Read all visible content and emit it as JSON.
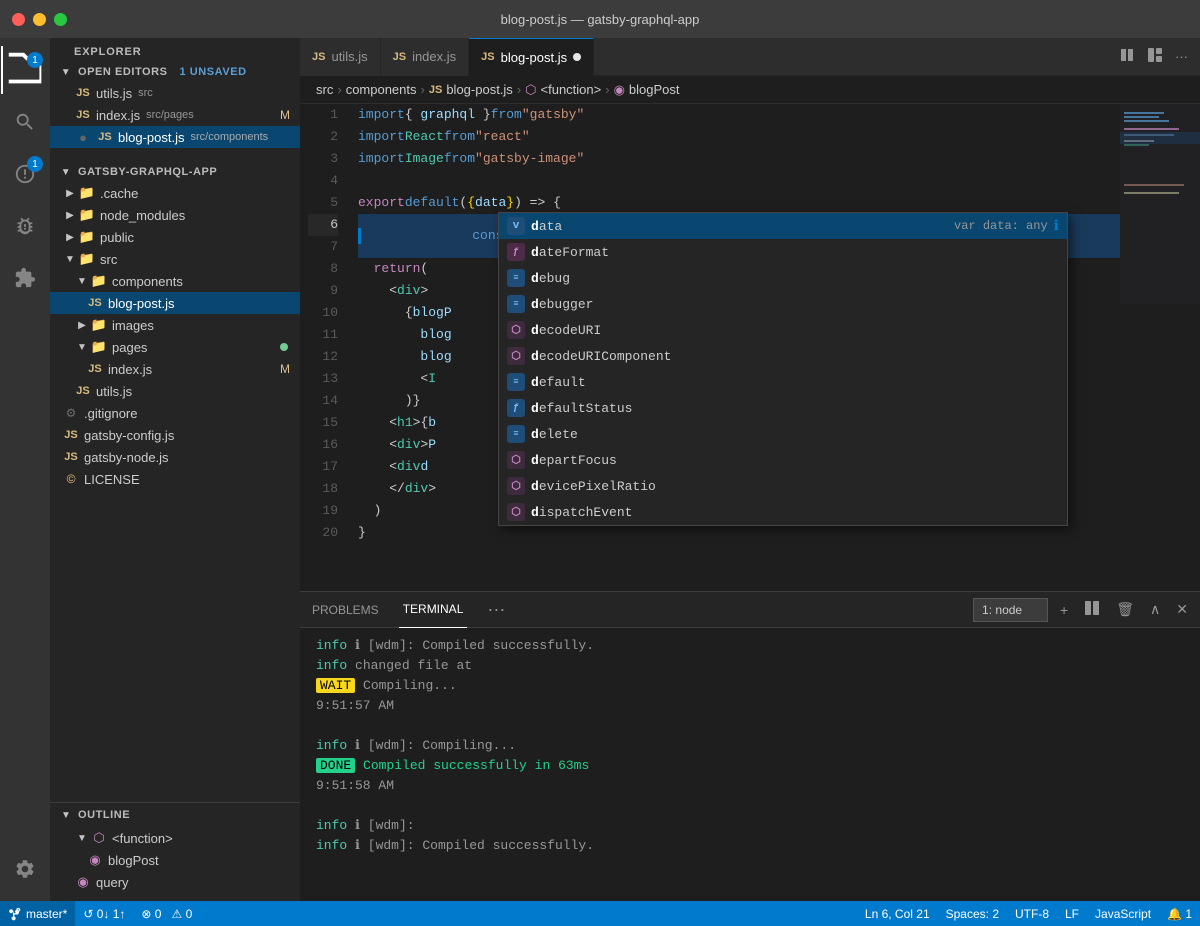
{
  "titlebar": {
    "title": "blog-post.js — gatsby-graphql-app"
  },
  "tabs": [
    {
      "id": "utils",
      "label": "utils.js",
      "type": "js",
      "active": false,
      "modified": false
    },
    {
      "id": "index",
      "label": "index.js",
      "type": "js",
      "active": false,
      "modified": false
    },
    {
      "id": "blog-post",
      "label": "blog-post.js",
      "type": "js",
      "active": true,
      "modified": true
    }
  ],
  "breadcrumb": {
    "parts": [
      "src",
      "components",
      "blog-post.js",
      "<function>",
      "blogPost"
    ]
  },
  "sidebar": {
    "title": "EXPLORER",
    "openEditors": {
      "label": "OPEN EDITORS",
      "badge": "1 UNSAVED"
    },
    "projectName": "GATSBY-GRAPHQL-APP",
    "files": [
      {
        "name": "utils.js",
        "path": "src",
        "type": "js",
        "indent": 2
      },
      {
        "name": "index.js",
        "path": "src/pages",
        "type": "js",
        "indent": 2,
        "badge": "M"
      },
      {
        "name": "blog-post.js",
        "path": "src/components",
        "type": "js",
        "indent": 2,
        "active": true
      },
      {
        "name": ".cache",
        "type": "folder",
        "indent": 1,
        "collapsed": true
      },
      {
        "name": "node_modules",
        "type": "folder",
        "indent": 1,
        "collapsed": true
      },
      {
        "name": "public",
        "type": "folder",
        "indent": 1,
        "collapsed": true
      },
      {
        "name": "src",
        "type": "folder",
        "indent": 1,
        "expanded": true
      },
      {
        "name": "components",
        "type": "folder",
        "indent": 2,
        "expanded": true
      },
      {
        "name": "blog-post.js",
        "type": "js",
        "indent": 3,
        "active": true
      },
      {
        "name": "images",
        "type": "folder",
        "indent": 2,
        "collapsed": true
      },
      {
        "name": "pages",
        "type": "folder",
        "indent": 2,
        "expanded": true,
        "dot": true
      },
      {
        "name": "index.js",
        "type": "js",
        "indent": 3,
        "badge": "M"
      },
      {
        "name": "utils.js",
        "type": "js",
        "indent": 2
      },
      {
        "name": ".gitignore",
        "type": "dot",
        "indent": 1
      },
      {
        "name": "gatsby-config.js",
        "type": "js",
        "indent": 1
      },
      {
        "name": "gatsby-node.js",
        "type": "js",
        "indent": 1
      },
      {
        "name": "LICENSE",
        "type": "license",
        "indent": 1
      }
    ],
    "outline": {
      "label": "OUTLINE",
      "items": [
        {
          "name": "<function>",
          "type": "func",
          "indent": 2,
          "expanded": true
        },
        {
          "name": "blogPost",
          "type": "mod",
          "indent": 3
        },
        {
          "name": "query",
          "type": "mod",
          "indent": 2
        }
      ]
    }
  },
  "code": {
    "lines": [
      {
        "num": 1,
        "text": "import { graphql } from \"gatsby\""
      },
      {
        "num": 2,
        "text": "import React from \"react\""
      },
      {
        "num": 3,
        "text": "import Image from \"gatsby-image\""
      },
      {
        "num": 4,
        "text": ""
      },
      {
        "num": 5,
        "text": "export default ({ data }) => {"
      },
      {
        "num": 6,
        "text": "  const blogPost = d",
        "active": true
      },
      {
        "num": 7,
        "text": "  return ("
      },
      {
        "num": 8,
        "text": "    <div>"
      },
      {
        "num": 9,
        "text": "      {blogP"
      },
      {
        "num": 10,
        "text": "        blog"
      },
      {
        "num": 11,
        "text": "        blog"
      },
      {
        "num": 12,
        "text": "        <I"
      },
      {
        "num": 13,
        "text": "        )}"
      },
      {
        "num": 14,
        "text": "      <h1>{b"
      },
      {
        "num": 15,
        "text": "      <div>P"
      },
      {
        "num": 16,
        "text": "      <div d"
      },
      {
        "num": 17,
        "text": "    </div>"
      },
      {
        "num": 18,
        "text": "  )"
      },
      {
        "num": 19,
        "text": "}"
      },
      {
        "num": 20,
        "text": ""
      }
    ]
  },
  "autocomplete": {
    "items": [
      {
        "label": "data",
        "icon": "var",
        "typeHint": "var data: any",
        "showInfo": true,
        "selected": true
      },
      {
        "label": "dateFormat",
        "icon": "fn"
      },
      {
        "label": "debug",
        "icon": "kw"
      },
      {
        "label": "debugger",
        "icon": "kw"
      },
      {
        "label": "decodeURI",
        "icon": "mod"
      },
      {
        "label": "decodeURIComponent",
        "icon": "mod"
      },
      {
        "label": "default",
        "icon": "kw"
      },
      {
        "label": "defaultStatus",
        "icon": "var"
      },
      {
        "label": "delete",
        "icon": "kw"
      },
      {
        "label": "departFocus",
        "icon": "mod"
      },
      {
        "label": "devicePixelRatio",
        "icon": "mod"
      },
      {
        "label": "dispatchEvent",
        "icon": "mod"
      }
    ]
  },
  "terminal": {
    "tabs": [
      "PROBLEMS",
      "TERMINAL"
    ],
    "activeTab": "TERMINAL",
    "selector": "1: node",
    "lines": [
      {
        "type": "info",
        "text": "ℹ [wdm]: Compiled successfully."
      },
      {
        "type": "info",
        "text": "ℹ changed file at"
      },
      {
        "type": "wait",
        "badge": "WAIT",
        "text": " Compiling..."
      },
      {
        "type": "time",
        "text": "9:51:57 AM"
      },
      {
        "type": "blank"
      },
      {
        "type": "info",
        "text": "ℹ [wdm]: Compiling..."
      },
      {
        "type": "done",
        "badge": "DONE",
        "text": " Compiled successfully in 63ms"
      },
      {
        "type": "time",
        "text": "9:51:58 AM"
      },
      {
        "type": "blank"
      },
      {
        "type": "info",
        "text": "ℹ [wdm]:"
      },
      {
        "type": "info",
        "text": "ℹ [wdm]: Compiled successfully."
      }
    ]
  },
  "statusbar": {
    "branch": "master*",
    "sync": "↺ 0↓ 1↑",
    "errors": "⊗ 0",
    "warnings": "⚠ 0",
    "line": "Ln 6, Col 21",
    "spaces": "Spaces: 2",
    "encoding": "UTF-8",
    "eol": "LF",
    "language": "JavaScript",
    "bell": "🔔 1"
  }
}
